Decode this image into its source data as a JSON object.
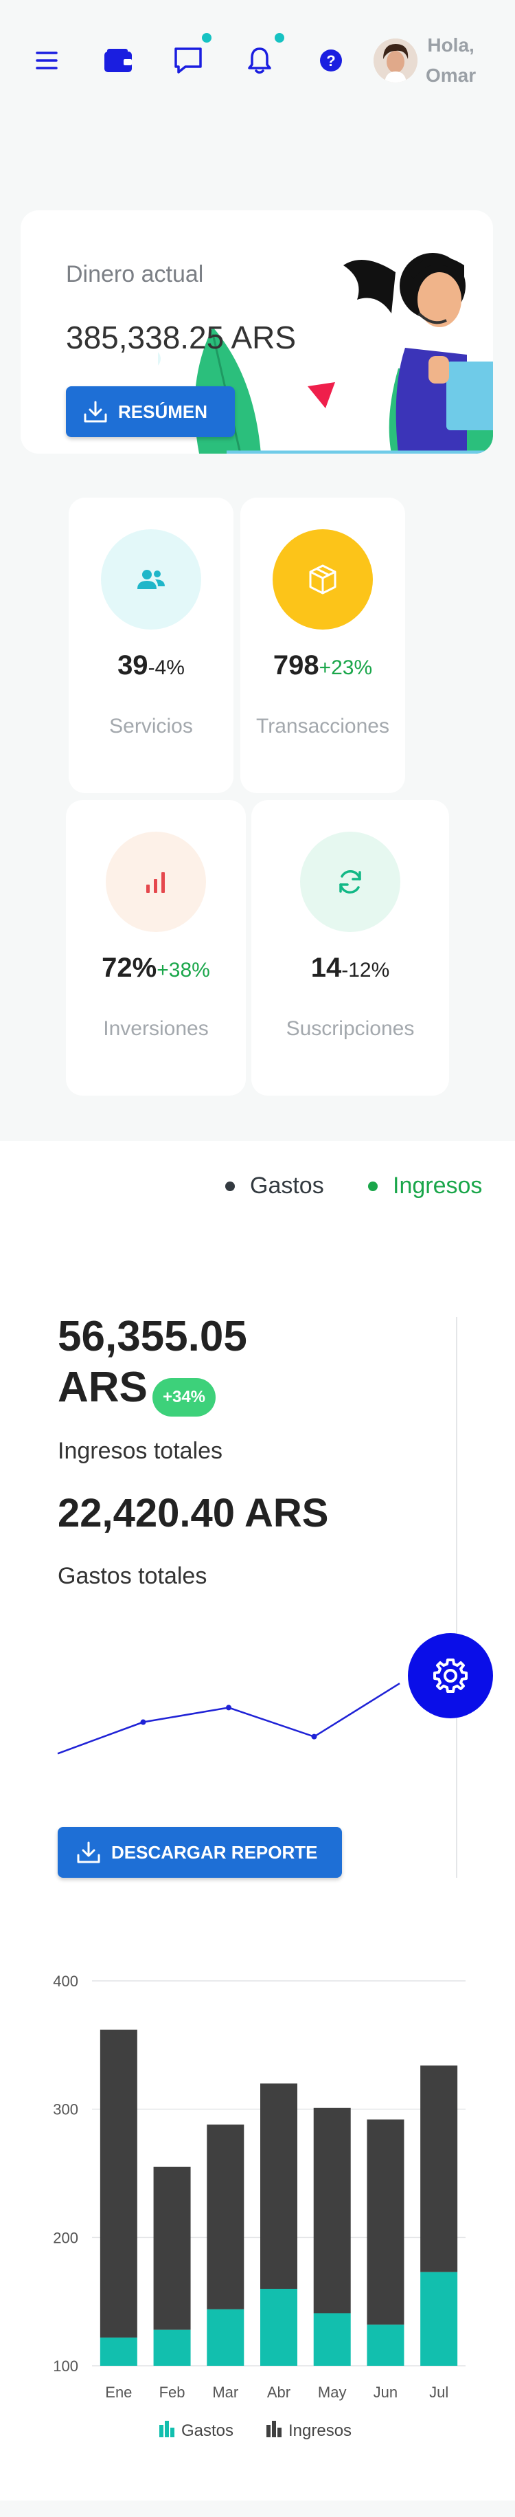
{
  "header": {
    "icons": [
      "menu-icon",
      "wallet-icon",
      "chat-icon",
      "bell-icon",
      "help-icon"
    ],
    "greeting_line1": "Hola,",
    "greeting_line2": "Omar"
  },
  "balance": {
    "label": "Dinero actual",
    "value": "385,338.25 ARS",
    "button_label": "RESÚMEN"
  },
  "stats": [
    {
      "value": "39",
      "change": "-4%",
      "label": "Servicios",
      "icon": "users-icon",
      "circle": "#e3f8f9",
      "icon_color": "#1fb6c9",
      "change_color": "#222"
    },
    {
      "value": "798",
      "change": "+23%",
      "label": "Transacciones",
      "icon": "box-icon",
      "circle": "#fcc419",
      "icon_color": "#ffffff",
      "change_color": "#1aa64a"
    },
    {
      "value": "72%",
      "change": "+38%",
      "label": "Inversiones",
      "icon": "bar-chart-icon",
      "circle": "#fdf1e8",
      "icon_color": "#e5484d",
      "change_color": "#1aa64a"
    },
    {
      "value": "14",
      "change": "-12%",
      "label": "Suscripciones",
      "icon": "refresh-icon",
      "circle": "#e6f8f0",
      "icon_color": "#12b886",
      "change_color": "#222"
    }
  ],
  "income": {
    "legend_gastos": "Gastos",
    "legend_ingresos": "Ingresos",
    "total_income_line1": "56,355.05",
    "total_income_line2": "ARS",
    "badge": "+34%",
    "total_income_label": "Ingresos totales",
    "total_expenses": "22,420.40 ARS",
    "total_expenses_label": "Gastos totales",
    "download_label": "DESCARGAR REPORTE",
    "colors": {
      "gastos_dot": "#333a40",
      "ingresos": "#1aa64a",
      "line": "#1f22d6"
    }
  },
  "sparkline": [
    22,
    48,
    60,
    36,
    80
  ],
  "chart_data": {
    "type": "bar",
    "stacked": true,
    "categories": [
      "Ene",
      "Feb",
      "Mar",
      "Abr",
      "May",
      "Jun",
      "Jul"
    ],
    "series": [
      {
        "name": "Gastos",
        "values": [
          122,
          128,
          144,
          160,
          141,
          132,
          173
        ],
        "color": "#12bfae"
      },
      {
        "name": "Ingresos",
        "values": [
          362,
          255,
          288,
          320,
          301,
          292,
          334
        ],
        "color": "#404040"
      }
    ],
    "ylim": [
      100,
      400
    ],
    "yticks": [
      "100",
      "200",
      "300",
      "400"
    ],
    "grid": true,
    "legend": "bottom"
  }
}
